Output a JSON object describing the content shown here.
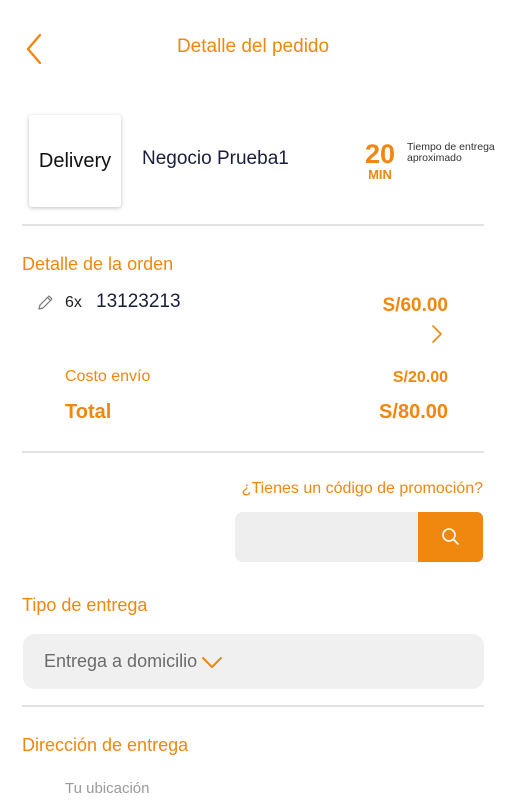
{
  "header": {
    "title": "Detalle del pedido",
    "back_icon": "chevron-left-icon"
  },
  "store": {
    "logo_text": "Delivery",
    "name": "Negocio Prueba1",
    "eta_value": "20",
    "eta_unit": "MIN",
    "eta_label": "Tiempo de entrega aproximado"
  },
  "order": {
    "section_title": "Detalle de la orden",
    "items": [
      {
        "quantity": "6x",
        "name": "13123213",
        "price": "S/60.00"
      }
    ],
    "shipping_label": "Costo envío",
    "shipping_value": "S/20.00",
    "total_label": "Total",
    "total_value": "S/80.00"
  },
  "promo": {
    "question": "¿Tienes un código de promoción?",
    "input_value": "",
    "search_icon": "search-icon"
  },
  "delivery_type": {
    "section_title": "Tipo de entrega",
    "selected": "Entrega a domicilio"
  },
  "address": {
    "section_title": "Dirección de entrega",
    "placeholder": "Tu ubicación"
  },
  "colors": {
    "accent": "#f0870f",
    "dark_text": "#1a1e3c",
    "divider": "#e2e2e2",
    "field_bg": "#f0f0f0"
  }
}
